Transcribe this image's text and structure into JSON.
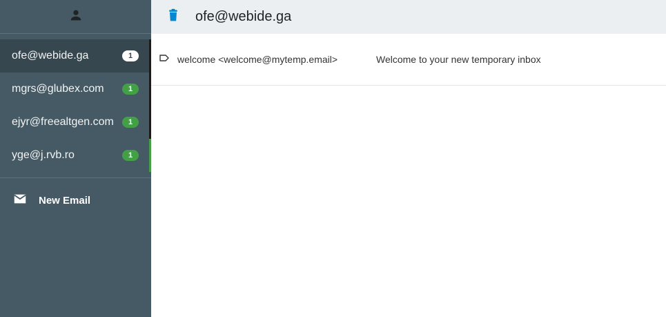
{
  "sidebar": {
    "header_icon": "person-icon",
    "accounts": [
      {
        "address": "ofe@webide.ga",
        "count": "1",
        "active": true
      },
      {
        "address": "mgrs@glubex.com",
        "count": "1",
        "active": false
      },
      {
        "address": "ejyr@freealtgen.com",
        "count": "1",
        "active": false
      },
      {
        "address": "yge@j.rvb.ro",
        "count": "1",
        "active": false
      }
    ],
    "new_email": {
      "icon": "mail-icon",
      "label": "New Email"
    }
  },
  "topbar": {
    "delete_icon": "trash-icon",
    "title": "ofe@webide.ga"
  },
  "messages": [
    {
      "icon": "label-icon",
      "sender": "welcome <welcome@mytemp.email>",
      "subject": "Welcome to your new temporary inbox"
    }
  ],
  "colors": {
    "sidebar": "#455a64",
    "sidebar_active": "#37474f",
    "badge_green": "#43a047",
    "accent_blue": "#0288d1",
    "topbar": "#eceff1"
  }
}
